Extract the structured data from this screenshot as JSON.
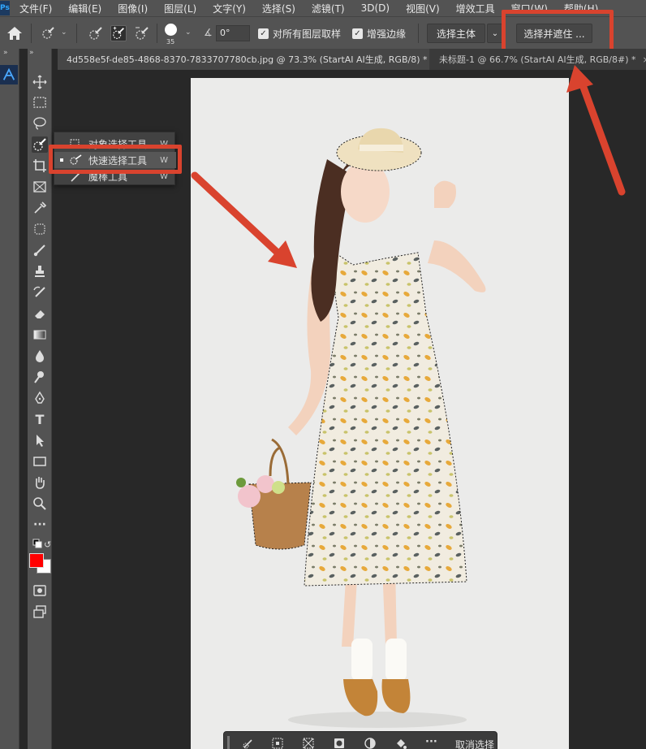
{
  "menu": {
    "logo": "Ps",
    "items": [
      "文件(F)",
      "编辑(E)",
      "图像(I)",
      "图层(L)",
      "文字(Y)",
      "选择(S)",
      "滤镜(T)",
      "3D(D)",
      "视图(V)",
      "增效工具",
      "窗口(W)",
      "帮助(H)"
    ]
  },
  "options": {
    "brush_size": "35",
    "angle_value": "0°",
    "sample_all_layers_label": "对所有图层取样",
    "sample_all_layers_checked": true,
    "enhance_edge_label": "增强边缘",
    "enhance_edge_checked": true,
    "select_subject_label": "选择主体",
    "select_and_mask_label": "选择并遮住 ..."
  },
  "tabs": [
    {
      "label": "4d558e5f-de85-4868-8370-7833707780cb.jpg @ 73.3% (StartAI AI生成, RGB/8) *",
      "close": "×",
      "active": true
    },
    {
      "label": "未标题-1 @ 66.7% (StartAI AI生成, RGB/8#) *",
      "close": "×",
      "active": false
    }
  ],
  "flyout": {
    "items": [
      {
        "label": "对象选择工具",
        "key": "W"
      },
      {
        "label": "快速选择工具",
        "key": "W"
      },
      {
        "label": "魔棒工具",
        "key": "W"
      }
    ]
  },
  "context_bar": {
    "deselect_label": "取消选择"
  },
  "colors": {
    "foreground": "#ff0000",
    "background": "#ffffff",
    "annotation": "#d9432e"
  }
}
